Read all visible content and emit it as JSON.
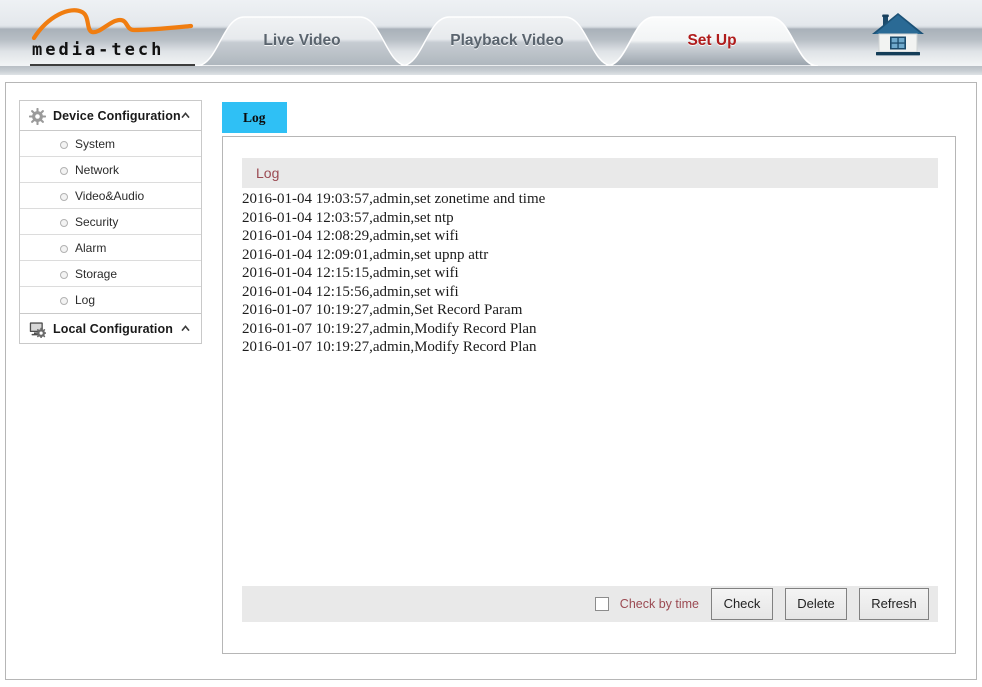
{
  "header": {
    "brand": "media-tech",
    "brand_icon": "swoosh-logo",
    "home_icon": "home-icon",
    "tabs": [
      {
        "label": "Live Video",
        "active": false
      },
      {
        "label": "Playback Video",
        "active": false
      },
      {
        "label": "Set Up",
        "active": true
      }
    ],
    "active_tab_color": "#b01c1c",
    "inactive_tab_color": "#5a646e"
  },
  "sidebar": {
    "sections": [
      {
        "label": "Device Configuration",
        "icon": "gear-icon",
        "caret": "chevron-up-icon",
        "expanded": true,
        "items": [
          {
            "label": "System",
            "icon": "radio-bullet-icon"
          },
          {
            "label": "Network",
            "icon": "radio-bullet-icon"
          },
          {
            "label": "Video&Audio",
            "icon": "radio-bullet-icon"
          },
          {
            "label": "Security",
            "icon": "radio-bullet-icon"
          },
          {
            "label": "Alarm",
            "icon": "radio-bullet-icon"
          },
          {
            "label": "Storage",
            "icon": "radio-bullet-icon"
          },
          {
            "label": "Log",
            "icon": "radio-bullet-icon"
          }
        ]
      },
      {
        "label": "Local Configuration",
        "icon": "monitor-gear-icon",
        "caret": "chevron-up-icon",
        "expanded": false,
        "items": []
      }
    ]
  },
  "main": {
    "tab": {
      "label": "Log",
      "active": true,
      "color": "#2fc0f5"
    },
    "panel_header": {
      "label": "Log",
      "color": "#9b4a52"
    },
    "log_entries": [
      "2016-01-04 19:03:57,admin,set zonetime and time",
      "2016-01-04 12:03:57,admin,set ntp",
      "2016-01-04 12:08:29,admin,set wifi",
      "2016-01-04 12:09:01,admin,set upnp attr",
      "2016-01-04 12:15:15,admin,set wifi",
      "2016-01-04 12:15:56,admin,set wifi",
      "2016-01-07 10:19:27,admin,Set Record Param",
      "2016-01-07 10:19:27,admin,Modify Record Plan",
      "2016-01-07 10:19:27,admin,Modify Record Plan"
    ],
    "footer": {
      "checkbox": {
        "label": "Check by time",
        "checked": false
      },
      "buttons": [
        {
          "label": "Check"
        },
        {
          "label": "Delete"
        },
        {
          "label": "Refresh"
        }
      ]
    }
  }
}
